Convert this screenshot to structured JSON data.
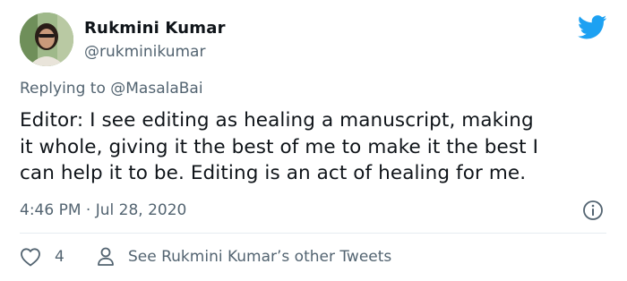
{
  "author": {
    "name": "Rukmini Kumar",
    "handle": "@rukminikumar"
  },
  "reply": {
    "prefix": "Replying to ",
    "mention": "@MasalaBai"
  },
  "tweet": {
    "lines": [
      "Editor: I see editing as healing a manuscript, making",
      "it whole, giving it the best of me to make it the best I",
      "can help it to be. Editing is an act of healing for me."
    ],
    "timestamp": "4:46 PM · Jul 28, 2020"
  },
  "actions": {
    "like_count": "4",
    "see_other": "See Rukmini Kumar’s other Tweets"
  },
  "icons": {
    "brand": "twitter-bird-icon",
    "info": "info-icon",
    "like": "heart-icon",
    "profile": "person-icon"
  },
  "colors": {
    "brand": "#1da1f2",
    "text": "#0f1419",
    "secondary": "#536471",
    "divider": "#e6ecf0"
  }
}
